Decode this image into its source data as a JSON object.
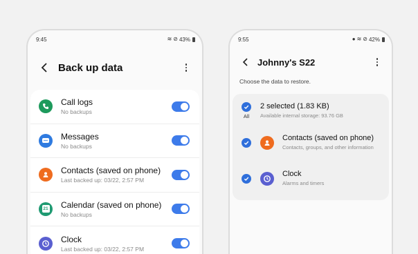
{
  "left_phone": {
    "status": {
      "time": "9:45",
      "battery": "43%"
    },
    "title": "Back up data",
    "items": [
      {
        "label": "Call logs",
        "sub": "No backups",
        "icon": "phone-icon",
        "color": "#1d9a5c",
        "enabled": true
      },
      {
        "label": "Messages",
        "sub": "No backups",
        "icon": "message-icon",
        "color": "#2f7be0",
        "enabled": true
      },
      {
        "label": "Contacts (saved on phone)",
        "sub": "Last backed up: 03/22, 2:57 PM",
        "icon": "contacts-icon",
        "color": "#ef6c1f",
        "enabled": true
      },
      {
        "label": "Calendar (saved on phone)",
        "sub": "No backups",
        "icon": "calendar-icon",
        "color": "#1f9a72",
        "enabled": true,
        "badge": "21"
      },
      {
        "label": "Clock",
        "sub": "Last backed up: 03/22, 2:57 PM",
        "icon": "clock-icon",
        "color": "#5a5fd0",
        "enabled": true
      }
    ]
  },
  "right_phone": {
    "status": {
      "time": "9:55",
      "battery": "42%"
    },
    "title": "Johnny's S22",
    "hint": "Choose the data to restore.",
    "select_all": {
      "title": "2 selected (1.83 KB)",
      "sub": "Available internal storage: 93.76 GB",
      "all_label": "All"
    },
    "items": [
      {
        "label": "Contacts (saved on phone)",
        "sub": "Contacts, groups, and other information",
        "icon": "contacts-icon",
        "color": "#ef6c1f",
        "checked": true
      },
      {
        "label": "Clock",
        "sub": "Alarms and timers",
        "icon": "clock-icon",
        "color": "#5a5fd0",
        "checked": true
      }
    ]
  }
}
